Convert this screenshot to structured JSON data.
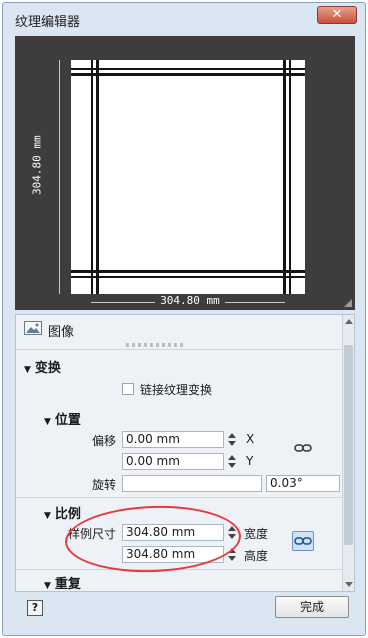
{
  "window": {
    "title": "纹理编辑器",
    "close_glyph": "✕"
  },
  "preview": {
    "dim_vertical": "304.80 mm",
    "dim_horizontal": "304.80 mm"
  },
  "image": {
    "label": "图像"
  },
  "transform": {
    "title": "变换",
    "link_checkbox_label": "链接纹理变换",
    "position": {
      "title": "位置",
      "offset_label": "偏移",
      "offset_x_value": "0.00 mm",
      "x_axis": "X",
      "offset_y_value": "0.00 mm",
      "y_axis": "Y",
      "rotation_label": "旋转",
      "rotation_value": "0.03°"
    },
    "scale": {
      "title": "比例",
      "sample_size_label": "样例尺寸",
      "width_value": "304.80 mm",
      "width_label": "宽度",
      "height_value": "304.80 mm",
      "height_label": "高度"
    },
    "repeat": {
      "title": "重复"
    }
  },
  "footer": {
    "help_label": "?",
    "ok_label": "完成"
  },
  "colors": {
    "annotation": "#e83a3a",
    "preview_bg": "#3e3c3d",
    "window_bg": "#dbe6f3"
  }
}
